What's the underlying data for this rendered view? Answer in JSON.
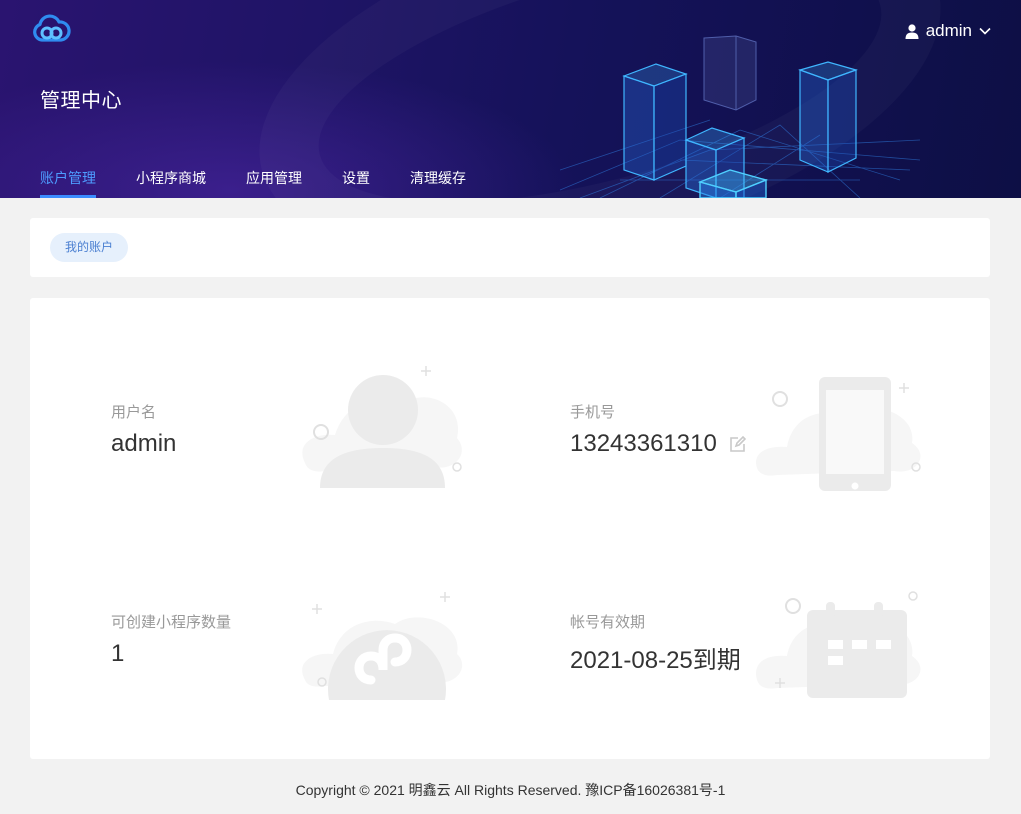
{
  "header": {
    "title": "管理中心",
    "user": "admin",
    "nav": [
      {
        "label": "账户管理",
        "active": true
      },
      {
        "label": "小程序商城",
        "active": false
      },
      {
        "label": "应用管理",
        "active": false
      },
      {
        "label": "设置",
        "active": false
      },
      {
        "label": "清理缓存",
        "active": false
      }
    ]
  },
  "breadcrumb": {
    "tag": "我的账户"
  },
  "account": {
    "username_label": "用户名",
    "username": "admin",
    "phone_label": "手机号",
    "phone": "13243361310",
    "quota_label": "可创建小程序数量",
    "quota": "1",
    "expiry_label": "帐号有效期",
    "expiry": "2021-08-25到期"
  },
  "footer": {
    "text": "Copyright © 2021 明鑫云 All Rights Reserved. 豫ICP备16026381号-1"
  },
  "colors": {
    "accent": "#3b8cff",
    "header_bg": "#1c1462",
    "illustration": "#ebebeb"
  },
  "icons": [
    "cloud-logo-icon",
    "user-icon",
    "chevron-down-icon",
    "edit-icon",
    "user-illustration-icon",
    "phone-illustration-icon",
    "mini-program-illustration-icon",
    "calendar-illustration-icon"
  ]
}
